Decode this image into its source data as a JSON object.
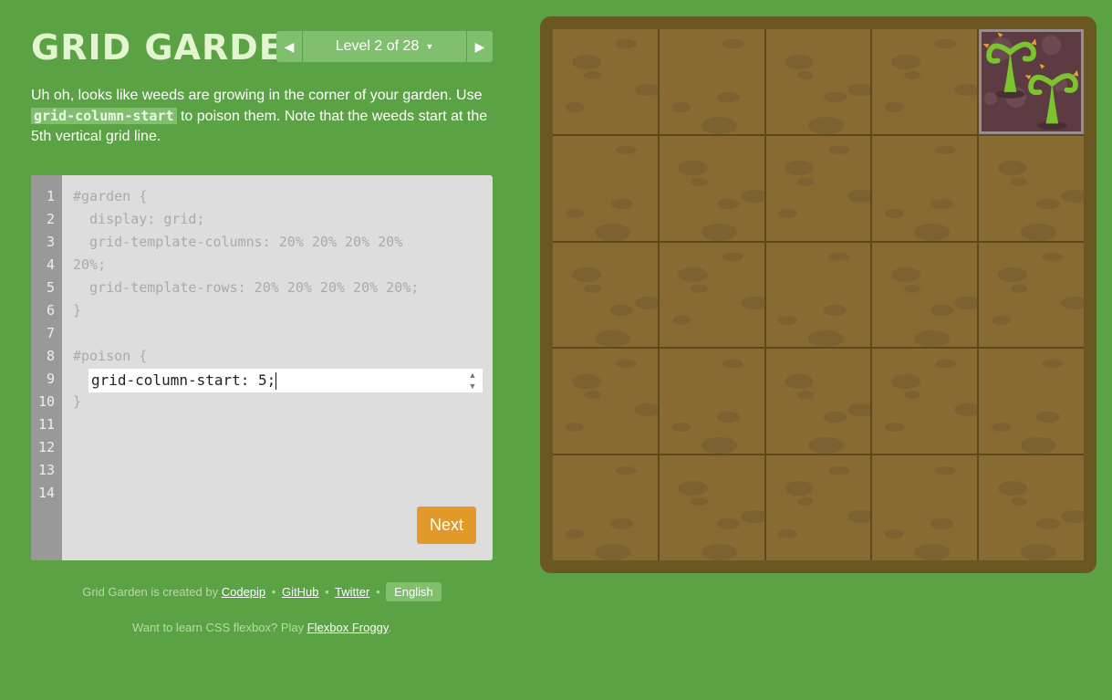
{
  "header": {
    "title": "GRID GARDEN",
    "level_label": "Level 2 of 28",
    "prev_icon": "triangle-left-icon",
    "next_icon": "triangle-right-icon",
    "dropdown_icon": "caret-down-icon"
  },
  "instructions": {
    "before": "Uh oh, looks like weeds are growing in the corner of your garden. Use ",
    "code": "grid-column-start",
    "after": " to poison them. Note that the weeds start at the 5th vertical grid line."
  },
  "editor": {
    "line_numbers": [
      "1",
      "2",
      "3",
      "4",
      "5",
      "6",
      "7",
      "8",
      "9",
      "10",
      "11",
      "12",
      "13",
      "14"
    ],
    "lines": [
      "#garden {",
      "  display: grid;",
      "  grid-template-columns: 20% 20% 20% 20%",
      "20%;",
      "  grid-template-rows: 20% 20% 20% 20% 20%;",
      "}",
      "",
      "#poison {",
      "}"
    ],
    "input_value": "grid-column-start: 5;",
    "next_label": "Next"
  },
  "footer": {
    "credit_prefix": "Grid Garden is created by",
    "codepip": "Codepip",
    "github": "GitHub",
    "twitter": "Twitter",
    "sep": "•",
    "language": "English",
    "flexbox_prefix": "Want to learn CSS flexbox? Play",
    "flexbox_link": "Flexbox Froggy",
    "flexbox_suffix": "."
  },
  "garden": {
    "columns": 5,
    "rows": 5,
    "poison_cell": {
      "column": 5,
      "row": 1
    },
    "colors": {
      "soil": "#876b33",
      "border": "#6b5722",
      "poison": "#5d3b43",
      "weed": "#7cc330"
    }
  },
  "colors": {
    "background": "#5aa244",
    "accent": "#7fbf6d",
    "next_button": "#e19a2a"
  }
}
